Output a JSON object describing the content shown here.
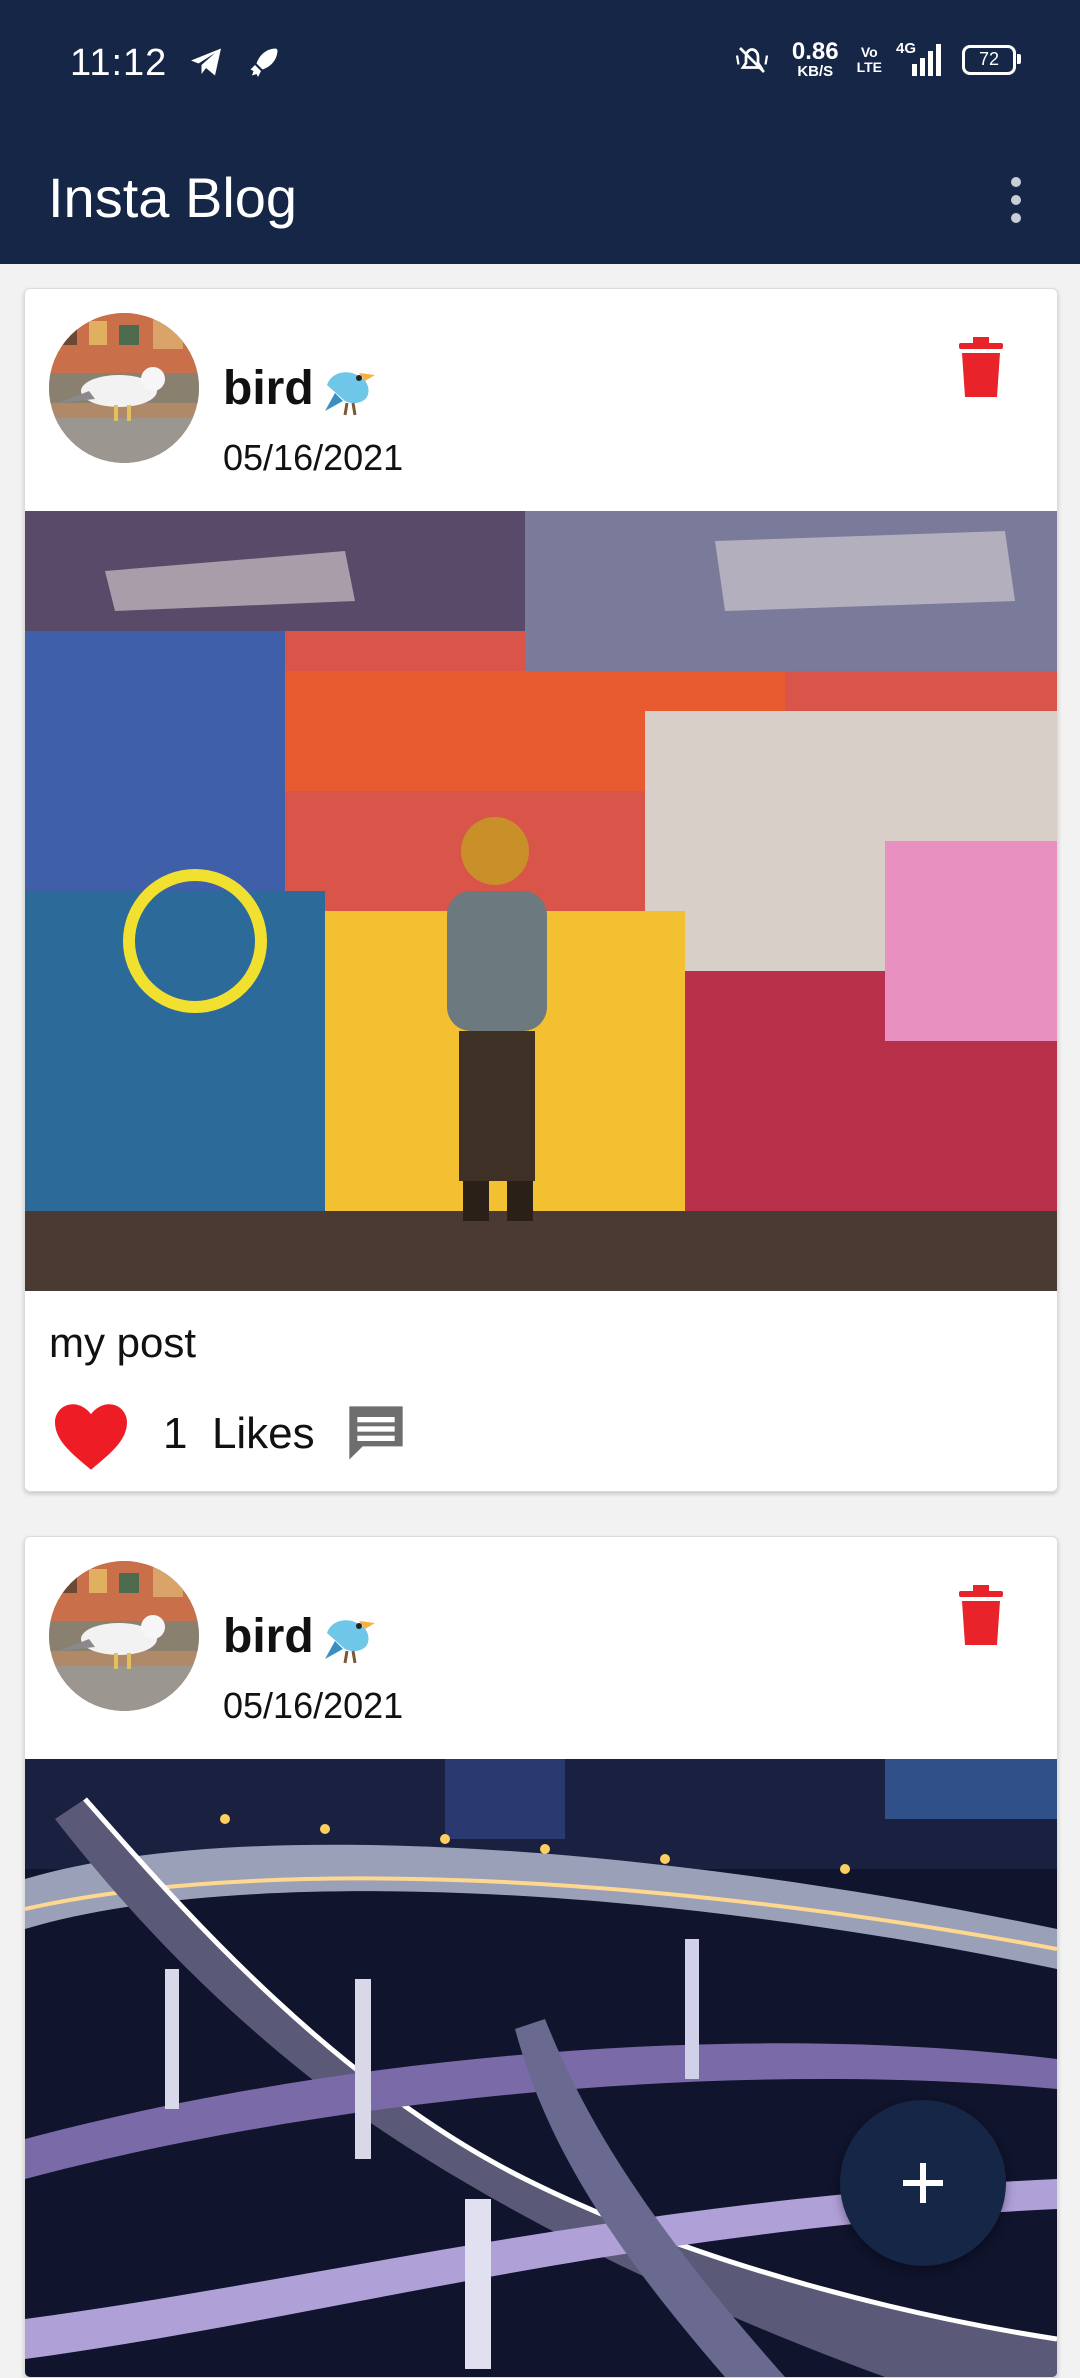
{
  "status_bar": {
    "time": "11:12",
    "net_speed_value": "0.86",
    "net_speed_unit": "KB/S",
    "volte_top": "Vo",
    "volte_bottom": "LTE",
    "network": "4G",
    "battery": "72",
    "icons": [
      "telegram-icon",
      "rocket-icon",
      "mute-icon",
      "signal-icon",
      "battery-icon"
    ]
  },
  "app_bar": {
    "title": "Insta Blog",
    "menu_icon": "more-vert-icon"
  },
  "posts": [
    {
      "username": "bird",
      "user_emoji": "🐦",
      "date": "05/16/2021",
      "image": "graffiti wall photo",
      "caption": "my post",
      "likes_count": "1",
      "likes_label": "Likes",
      "icons": [
        "delete-icon",
        "heart-icon",
        "comment-icon"
      ]
    },
    {
      "username": "bird",
      "user_emoji": "🐦",
      "date": "05/16/2021",
      "image": "highway interchange night photo",
      "caption": "",
      "likes_count": "",
      "likes_label": "",
      "icons": [
        "delete-icon"
      ]
    }
  ],
  "fab": {
    "label": "+",
    "icon": "add-icon"
  },
  "colors": {
    "app_bar": "#162646",
    "delete": "#e8232a",
    "heart": "#ee1c25",
    "comment": "#6e6e6e"
  }
}
